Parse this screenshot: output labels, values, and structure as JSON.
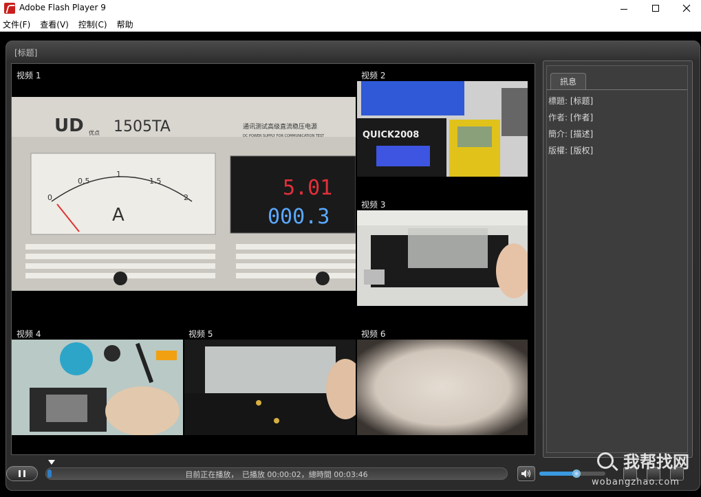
{
  "window": {
    "title": "Adobe Flash Player 9"
  },
  "menu": [
    "文件(F)",
    "查看(V)",
    "控制(C)",
    "帮助"
  ],
  "player": {
    "title": "[标题]",
    "videos": [
      {
        "label": "视频 1"
      },
      {
        "label": "视频 2"
      },
      {
        "label": "视频 3"
      },
      {
        "label": "视频 4"
      },
      {
        "label": "视频 5"
      },
      {
        "label": "视频 6"
      }
    ],
    "panel": {
      "tab": "訊息",
      "rows": [
        {
          "key": "標題:",
          "value": "[标题]"
        },
        {
          "key": "作者:",
          "value": "[作者]"
        },
        {
          "key": "簡介:",
          "value": "[描述]"
        },
        {
          "key": "版權:",
          "value": "[版权]"
        }
      ]
    },
    "controls": {
      "status": "目前正在播放，　已播放 00:00:02，總時間 00:03:46",
      "progress": 0.009,
      "volume": 0.56
    }
  },
  "screen_text": {
    "meter_model": "1505TA",
    "meter_brand": "优点",
    "meter_caption": "通讯测试高级直流稳压电源",
    "meter_caption_en": "DC POWER SUPPLY FOR COMMUNICATION TEST",
    "voltage": "5.01",
    "current": "000.3",
    "gauge_unit": "A",
    "gauge_ticks": [
      "0",
      "0.5",
      "1",
      "1.5",
      "2"
    ],
    "quick_brand": "QUICK2008"
  },
  "watermark": {
    "main": "我帮找网",
    "sub": "wobangzhao.com"
  }
}
